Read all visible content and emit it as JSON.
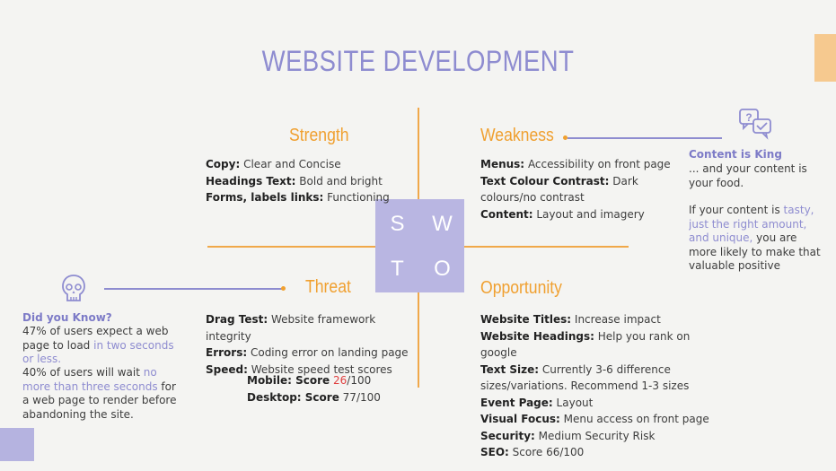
{
  "title": "WEBSITE DEVELOPMENT",
  "swot_letters": [
    "S",
    "W",
    "T",
    "O"
  ],
  "strength": {
    "heading": "Strength",
    "items": [
      {
        "label": "Copy:",
        "value": "Clear and Concise"
      },
      {
        "label": "Headings Text:",
        "value": "Bold and bright"
      },
      {
        "label": "Forms, labels links:",
        "value": "Functioning"
      }
    ]
  },
  "weakness": {
    "heading": "Weakness",
    "items": [
      {
        "label": "Menus:",
        "value": "Accessibility on front page"
      },
      {
        "label": "Text Colour Contrast:",
        "value": "Dark"
      },
      {
        "label": "",
        "value": "colours/no contrast"
      },
      {
        "label": "Content:",
        "value": "Layout and imagery"
      }
    ]
  },
  "threat": {
    "heading": "Threat",
    "items": [
      {
        "label": "Drag Test:",
        "value": "Website framework integrity"
      },
      {
        "label": "Errors:",
        "value": "Coding error on landing page"
      },
      {
        "label": "Speed:",
        "value": "Website speed test scores"
      }
    ],
    "scores": [
      {
        "label": "Mobile: Score",
        "score": "26",
        "max": "/100",
        "color": "#e04040"
      },
      {
        "label": "Desktop: Score",
        "score": "77",
        "max": "/100",
        "color": "#3d3d3d"
      }
    ]
  },
  "opportunity": {
    "heading": "Opportunity",
    "items": [
      {
        "label": "Website Titles:",
        "value": "Increase impact"
      },
      {
        "label": "Website Headings:",
        "value": "Help you rank on google"
      },
      {
        "label": "Text Size:",
        "value": "Currently 3-6 difference"
      },
      {
        "label": "",
        "value": "sizes/variations. Recommend 1-3 sizes"
      },
      {
        "label": "Event Page:",
        "value": "Layout"
      },
      {
        "label": "Visual Focus:",
        "value": "Menu access on front page"
      },
      {
        "label": "Security:",
        "value": "Medium Security Risk"
      },
      {
        "label": "SEO:",
        "value": "Score 66/100"
      }
    ]
  },
  "content_king": {
    "title": "Content is King",
    "line1": "... and your content is your food.",
    "p2_a": "If your content is ",
    "p2_hl": "tasty, just the right amount, and unique,",
    "p2_b": " you are more likely to make that valuable positive impression."
  },
  "did_you_know": {
    "title": "Did you Know?",
    "p1_a": "47% of users expect a web page to load ",
    "p1_hl": "in two seconds or less.",
    "p2_a": "40% of users will wait ",
    "p2_hl": "no more than three seconds",
    "p2_b": " for a web page to render before abandoning the site."
  },
  "colors": {
    "accent_purple": "#8e8cd0",
    "accent_orange": "#f0a030",
    "swot_box": "#b9b6e2",
    "background": "#f4f4f2"
  },
  "icons": [
    "question-chat-icon",
    "skull-icon"
  ]
}
